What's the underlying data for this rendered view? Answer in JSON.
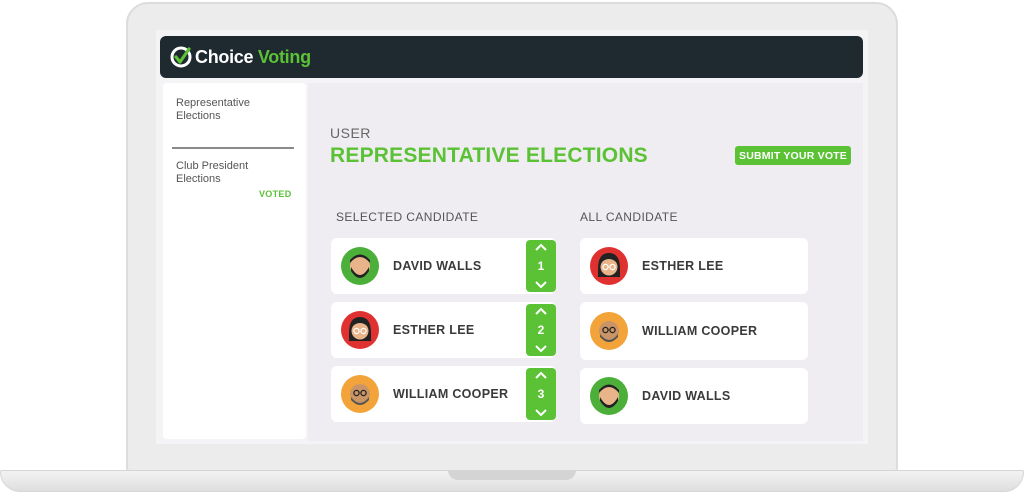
{
  "brand": {
    "name_part1": "Choice",
    "name_part2": " Voting",
    "accent_color": "#5bc236",
    "header_color": "#1e2a2f"
  },
  "sidebar": {
    "items": [
      {
        "label": "Representative Elections"
      },
      {
        "label": "Club President Elections",
        "badge": "VOTED"
      }
    ]
  },
  "main": {
    "user_label": "USER",
    "title": "REPRESENTATIVE ELECTIONS",
    "submit_label": "SUBMIT YOUR VOTE",
    "selected_heading": "SELECTED CANDIDATE",
    "all_heading": "ALL CANDIDATE",
    "selected": [
      {
        "name": "DAVID WALLS",
        "rank": "1",
        "avatar_color": "#4caf3a",
        "icon": "bearded-man-avatar-icon"
      },
      {
        "name": "ESTHER LEE",
        "rank": "2",
        "avatar_color": "#e03131",
        "icon": "woman-glasses-avatar-icon"
      },
      {
        "name": "WILLIAM COOPER",
        "rank": "3",
        "avatar_color": "#f2a33a",
        "icon": "bald-man-glasses-avatar-icon"
      }
    ],
    "all": [
      {
        "name": "ESTHER LEE",
        "avatar_color": "#e03131",
        "icon": "woman-glasses-avatar-icon"
      },
      {
        "name": "WILLIAM COOPER",
        "avatar_color": "#f2a33a",
        "icon": "bald-man-glasses-avatar-icon"
      },
      {
        "name": "DAVID WALLS",
        "avatar_color": "#4caf3a",
        "icon": "bearded-man-avatar-icon"
      }
    ]
  }
}
